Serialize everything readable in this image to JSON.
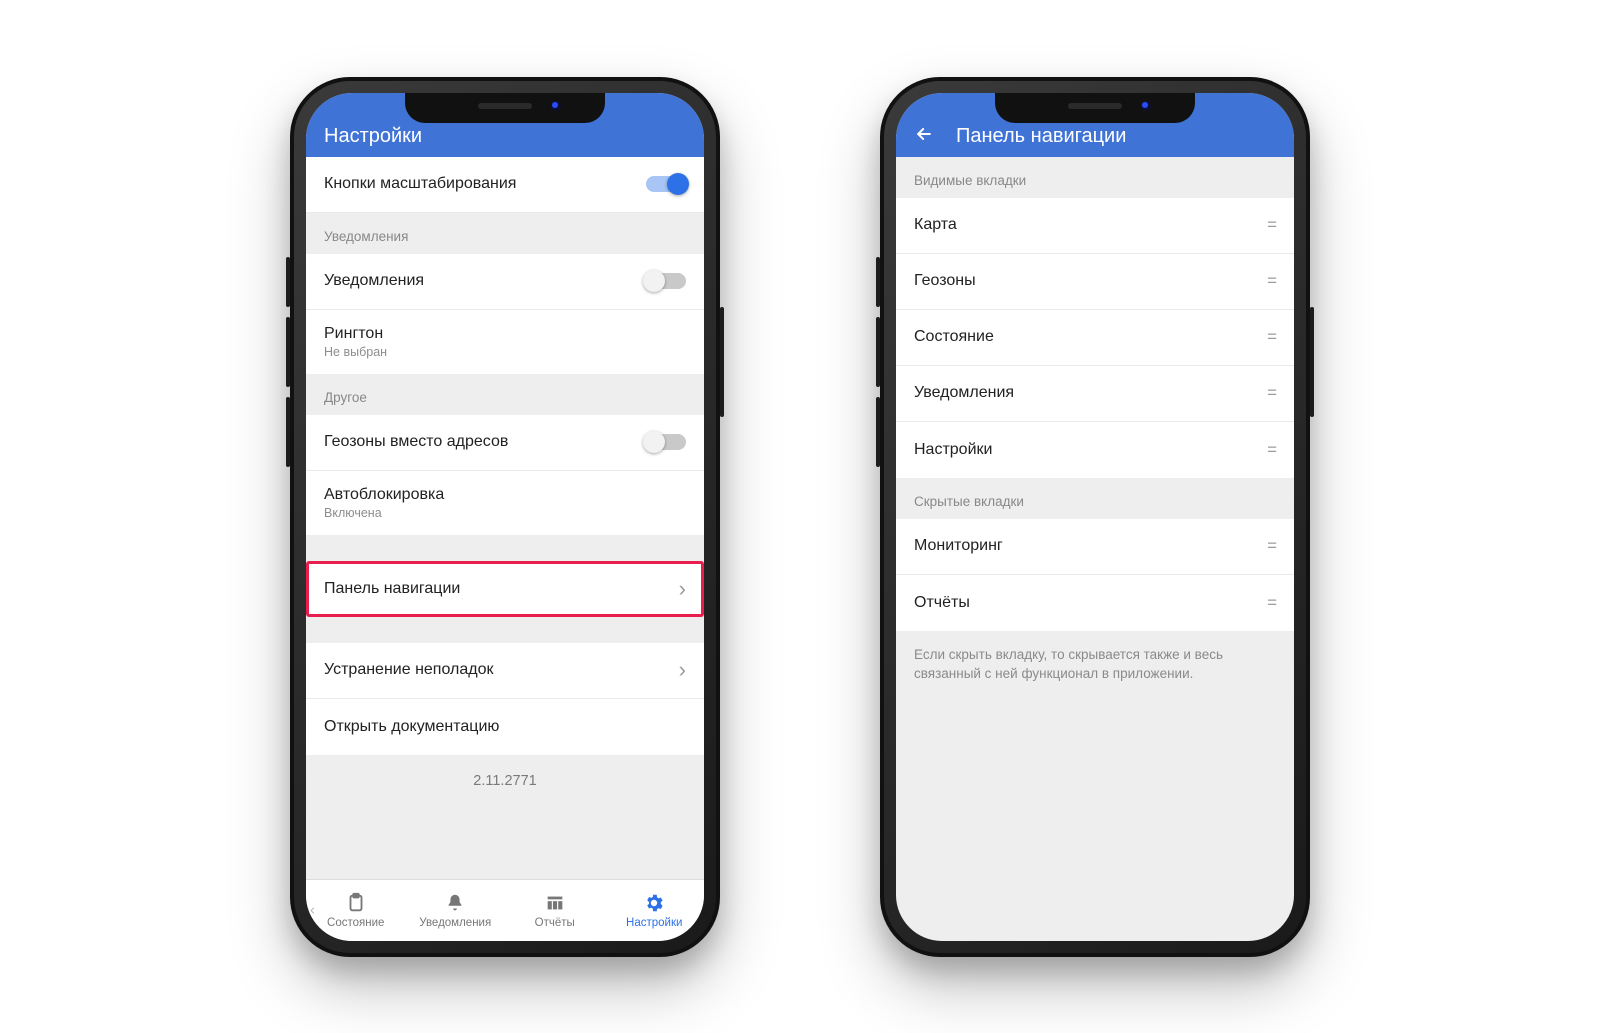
{
  "left": {
    "header_title": "Настройки",
    "zoom_buttons_label": "Кнопки масштабирования",
    "section_notifications": "Уведомления",
    "notifications_label": "Уведомления",
    "ringtone_label": "Рингтон",
    "ringtone_value": "Не выбран",
    "section_other": "Другое",
    "geozones_instead_label": "Геозоны вместо адресов",
    "autolock_label": "Автоблокировка",
    "autolock_value": "Включена",
    "nav_panel_label": "Панель навигации",
    "troubleshoot_label": "Устранение неполадок",
    "open_docs_label": "Открыть документацию",
    "version": "2.11.2771",
    "tabs": {
      "status": "Состояние",
      "notifications": "Уведомления",
      "reports": "Отчёты",
      "settings": "Настройки"
    }
  },
  "right": {
    "header_title": "Панель навигации",
    "section_visible": "Видимые вкладки",
    "visible": {
      "map": "Карта",
      "geozones": "Геозоны",
      "status": "Состояние",
      "notifications": "Уведомления",
      "settings": "Настройки"
    },
    "section_hidden": "Скрытые вкладки",
    "hidden": {
      "monitoring": "Мониторинг",
      "reports": "Отчёты"
    },
    "help_text": "Если скрыть вкладку, то скрывается также и весь связанный с ней функционал в приложении."
  }
}
